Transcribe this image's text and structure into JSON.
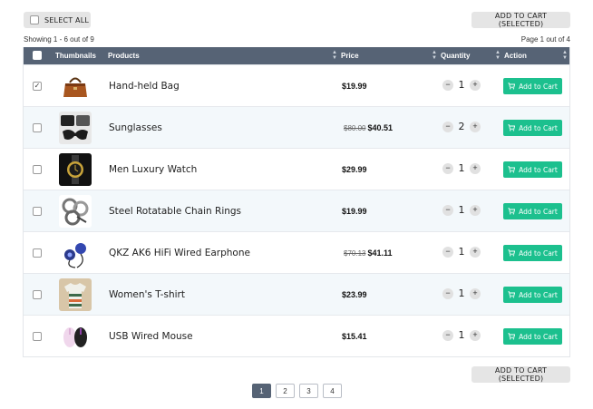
{
  "toolbar": {
    "select_all_label": "SELECT ALL",
    "add_to_cart_selected_label": "ADD TO CART (SELECTED)",
    "showing_text": "Showing 1 - 6 out of 9",
    "page_text": "Page 1 out of 4"
  },
  "table": {
    "columns": {
      "thumbnails": "Thumbnails",
      "products": "Products",
      "price": "Price",
      "quantity": "Quantity",
      "action": "Action"
    },
    "add_to_cart_label": "Add to Cart",
    "rows": [
      {
        "name": "Hand-held Bag",
        "old_price": "",
        "price": "$19.99",
        "quantity": "1",
        "checked": true,
        "thumb": "bag"
      },
      {
        "name": "Sunglasses",
        "old_price": "$80.00",
        "price": "$40.51",
        "quantity": "2",
        "checked": false,
        "thumb": "sunglasses"
      },
      {
        "name": "Men Luxury Watch",
        "old_price": "",
        "price": "$29.99",
        "quantity": "1",
        "checked": false,
        "thumb": "watch"
      },
      {
        "name": "Steel Rotatable Chain Rings",
        "old_price": "",
        "price": "$19.99",
        "quantity": "1",
        "checked": false,
        "thumb": "rings"
      },
      {
        "name": "QKZ AK6 HiFi Wired Earphone",
        "old_price": "$70.13",
        "price": "$41.11",
        "quantity": "1",
        "checked": false,
        "thumb": "earphone"
      },
      {
        "name": "Women's T-shirt",
        "old_price": "",
        "price": "$23.99",
        "quantity": "1",
        "checked": false,
        "thumb": "tshirt"
      },
      {
        "name": "USB Wired Mouse",
        "old_price": "",
        "price": "$15.41",
        "quantity": "1",
        "checked": false,
        "thumb": "mouse"
      }
    ]
  },
  "pagination": {
    "pages": [
      "1",
      "2",
      "3",
      "4"
    ],
    "current": "1"
  },
  "colors": {
    "header_bg": "#566375",
    "add_to_cart": "#1cc08e",
    "row_alt": "#f3f8fb"
  }
}
